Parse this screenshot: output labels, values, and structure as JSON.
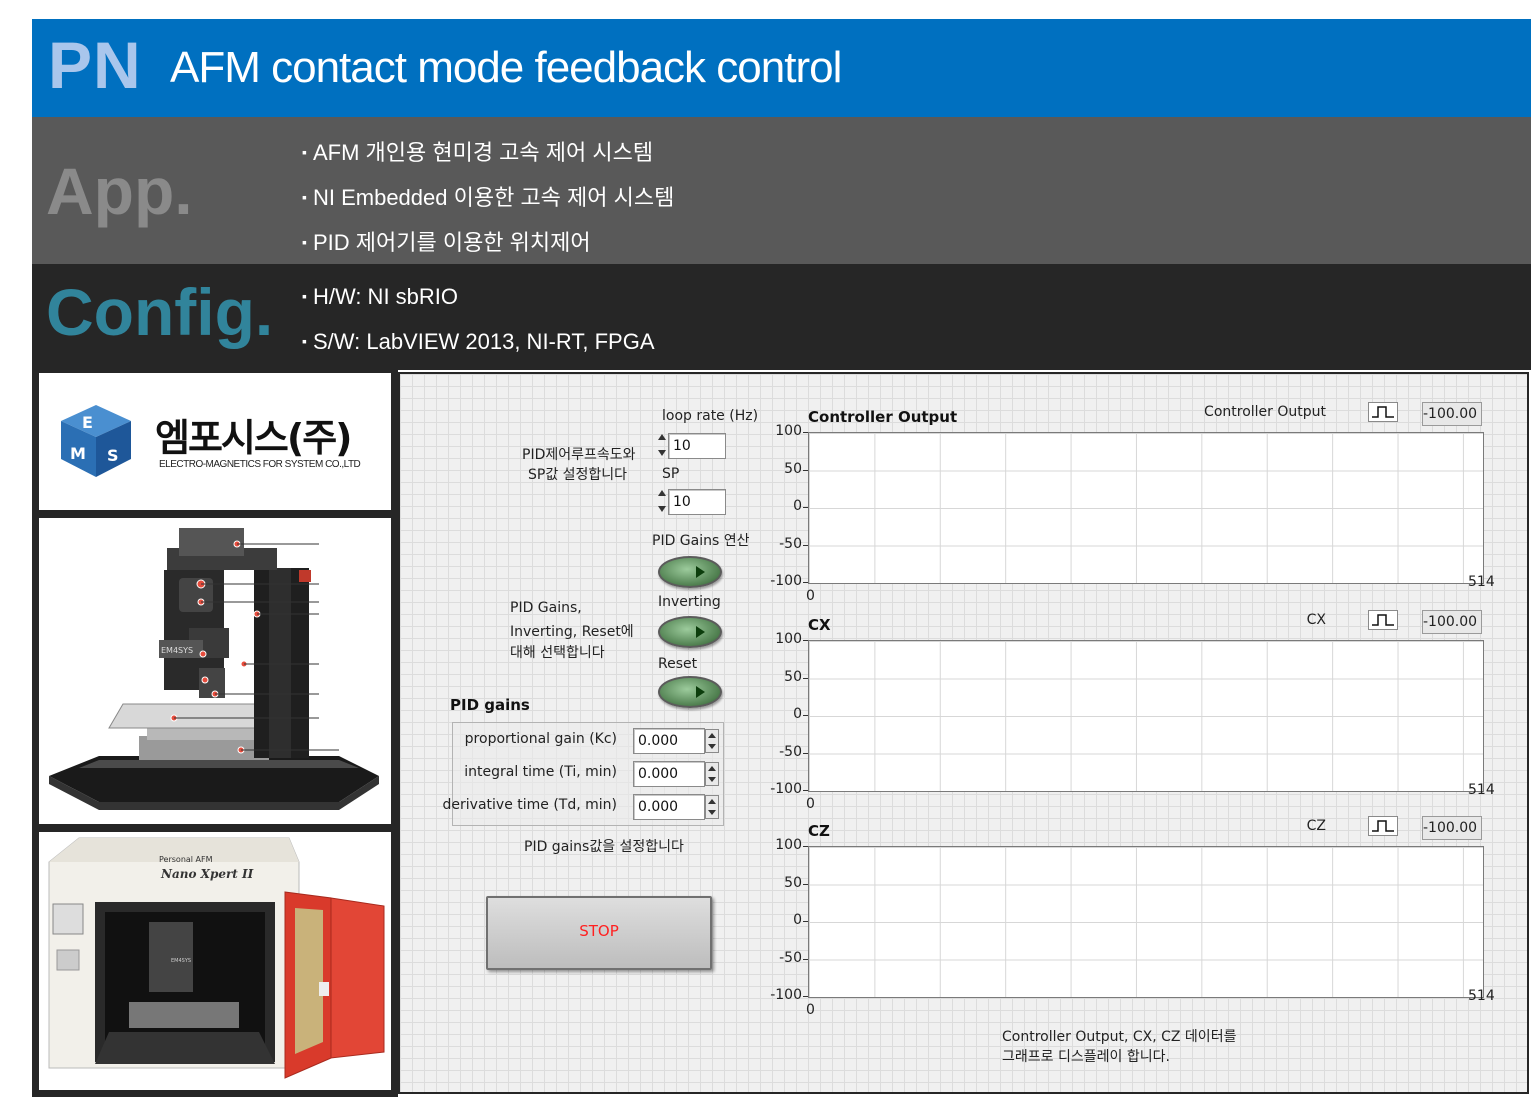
{
  "header": {
    "code": "PN",
    "title": "AFM contact mode feedback control"
  },
  "app": {
    "label": "App.",
    "bullets": [
      "AFM 개인용 현미경 고속 제어 시스템",
      "NI Embedded  이용한 고속 제어 시스템",
      "PID 제어기를 이용한 위치제어"
    ]
  },
  "config": {
    "label": "Config.",
    "bullets": [
      "H/W: NI sbRIO",
      "S/W: LabVIEW 2013, NI-RT, FPGA"
    ]
  },
  "logo": {
    "name": "엠포시스(주)",
    "sub": "ELECTRO-MAGNETICS FOR SYSTEM CO.,LTD",
    "mark_letters": [
      "E",
      "M",
      "S"
    ]
  },
  "product_images": {
    "afm_device_label": "EM4SYS",
    "enclosure_label_1": "Personal AFM",
    "enclosure_label_2": "Nano Xpert II",
    "enclosure_small": "EM4SYS"
  },
  "panel": {
    "loop_rate_label": "loop rate (Hz)",
    "loop_rate_value": "10",
    "sp_label": "SP",
    "sp_value": "10",
    "loop_note_1": "PID제어루프속도와",
    "loop_note_2": "SP값 설정합니다",
    "pid_compute_label": "PID Gains 연산",
    "inverting_label": "Inverting",
    "reset_label": "Reset",
    "select_note_1": "PID Gains,",
    "select_note_2": "Inverting, Reset에",
    "select_note_3": "대해 선택합니다",
    "gains_title": "PID gains",
    "gains": [
      {
        "label": "proportional gain (Kc)",
        "value": "0.000"
      },
      {
        "label": "integral time (Ti, min)",
        "value": "0.000"
      },
      {
        "label": "derivative time (Td, min)",
        "value": "0.000"
      }
    ],
    "gains_note": "PID gains값을 설정합니다",
    "stop_label": "STOP",
    "display_note_1": "Controller Output, CX, CZ 데이터를",
    "display_note_2": "그래프로 디스플레이 합니다."
  },
  "chart_data": [
    {
      "type": "line",
      "title": "Controller Output",
      "series": [
        {
          "name": "Controller Output",
          "values": []
        }
      ],
      "display_value": "-100.00",
      "yticks": [
        "100",
        "50",
        "0",
        "-50",
        "-100"
      ],
      "xticks": [
        "0",
        "514"
      ],
      "ylim": [
        -100,
        100
      ],
      "xlim": [
        0,
        514
      ],
      "grid": true,
      "legend": "top-right"
    },
    {
      "type": "line",
      "title": "CX",
      "series": [
        {
          "name": "CX",
          "values": []
        }
      ],
      "display_value": "-100.00",
      "yticks": [
        "100",
        "50",
        "0",
        "-50",
        "-100"
      ],
      "xticks": [
        "0",
        "514"
      ],
      "ylim": [
        -100,
        100
      ],
      "xlim": [
        0,
        514
      ],
      "grid": true,
      "legend": "top-right"
    },
    {
      "type": "line",
      "title": "CZ",
      "series": [
        {
          "name": "CZ",
          "values": []
        }
      ],
      "display_value": "-100.00",
      "yticks": [
        "100",
        "50",
        "0",
        "-50",
        "-100"
      ],
      "xticks": [
        "0",
        "514"
      ],
      "ylim": [
        -100,
        100
      ],
      "xlim": [
        0,
        514
      ],
      "grid": true,
      "legend": "top-right"
    }
  ]
}
